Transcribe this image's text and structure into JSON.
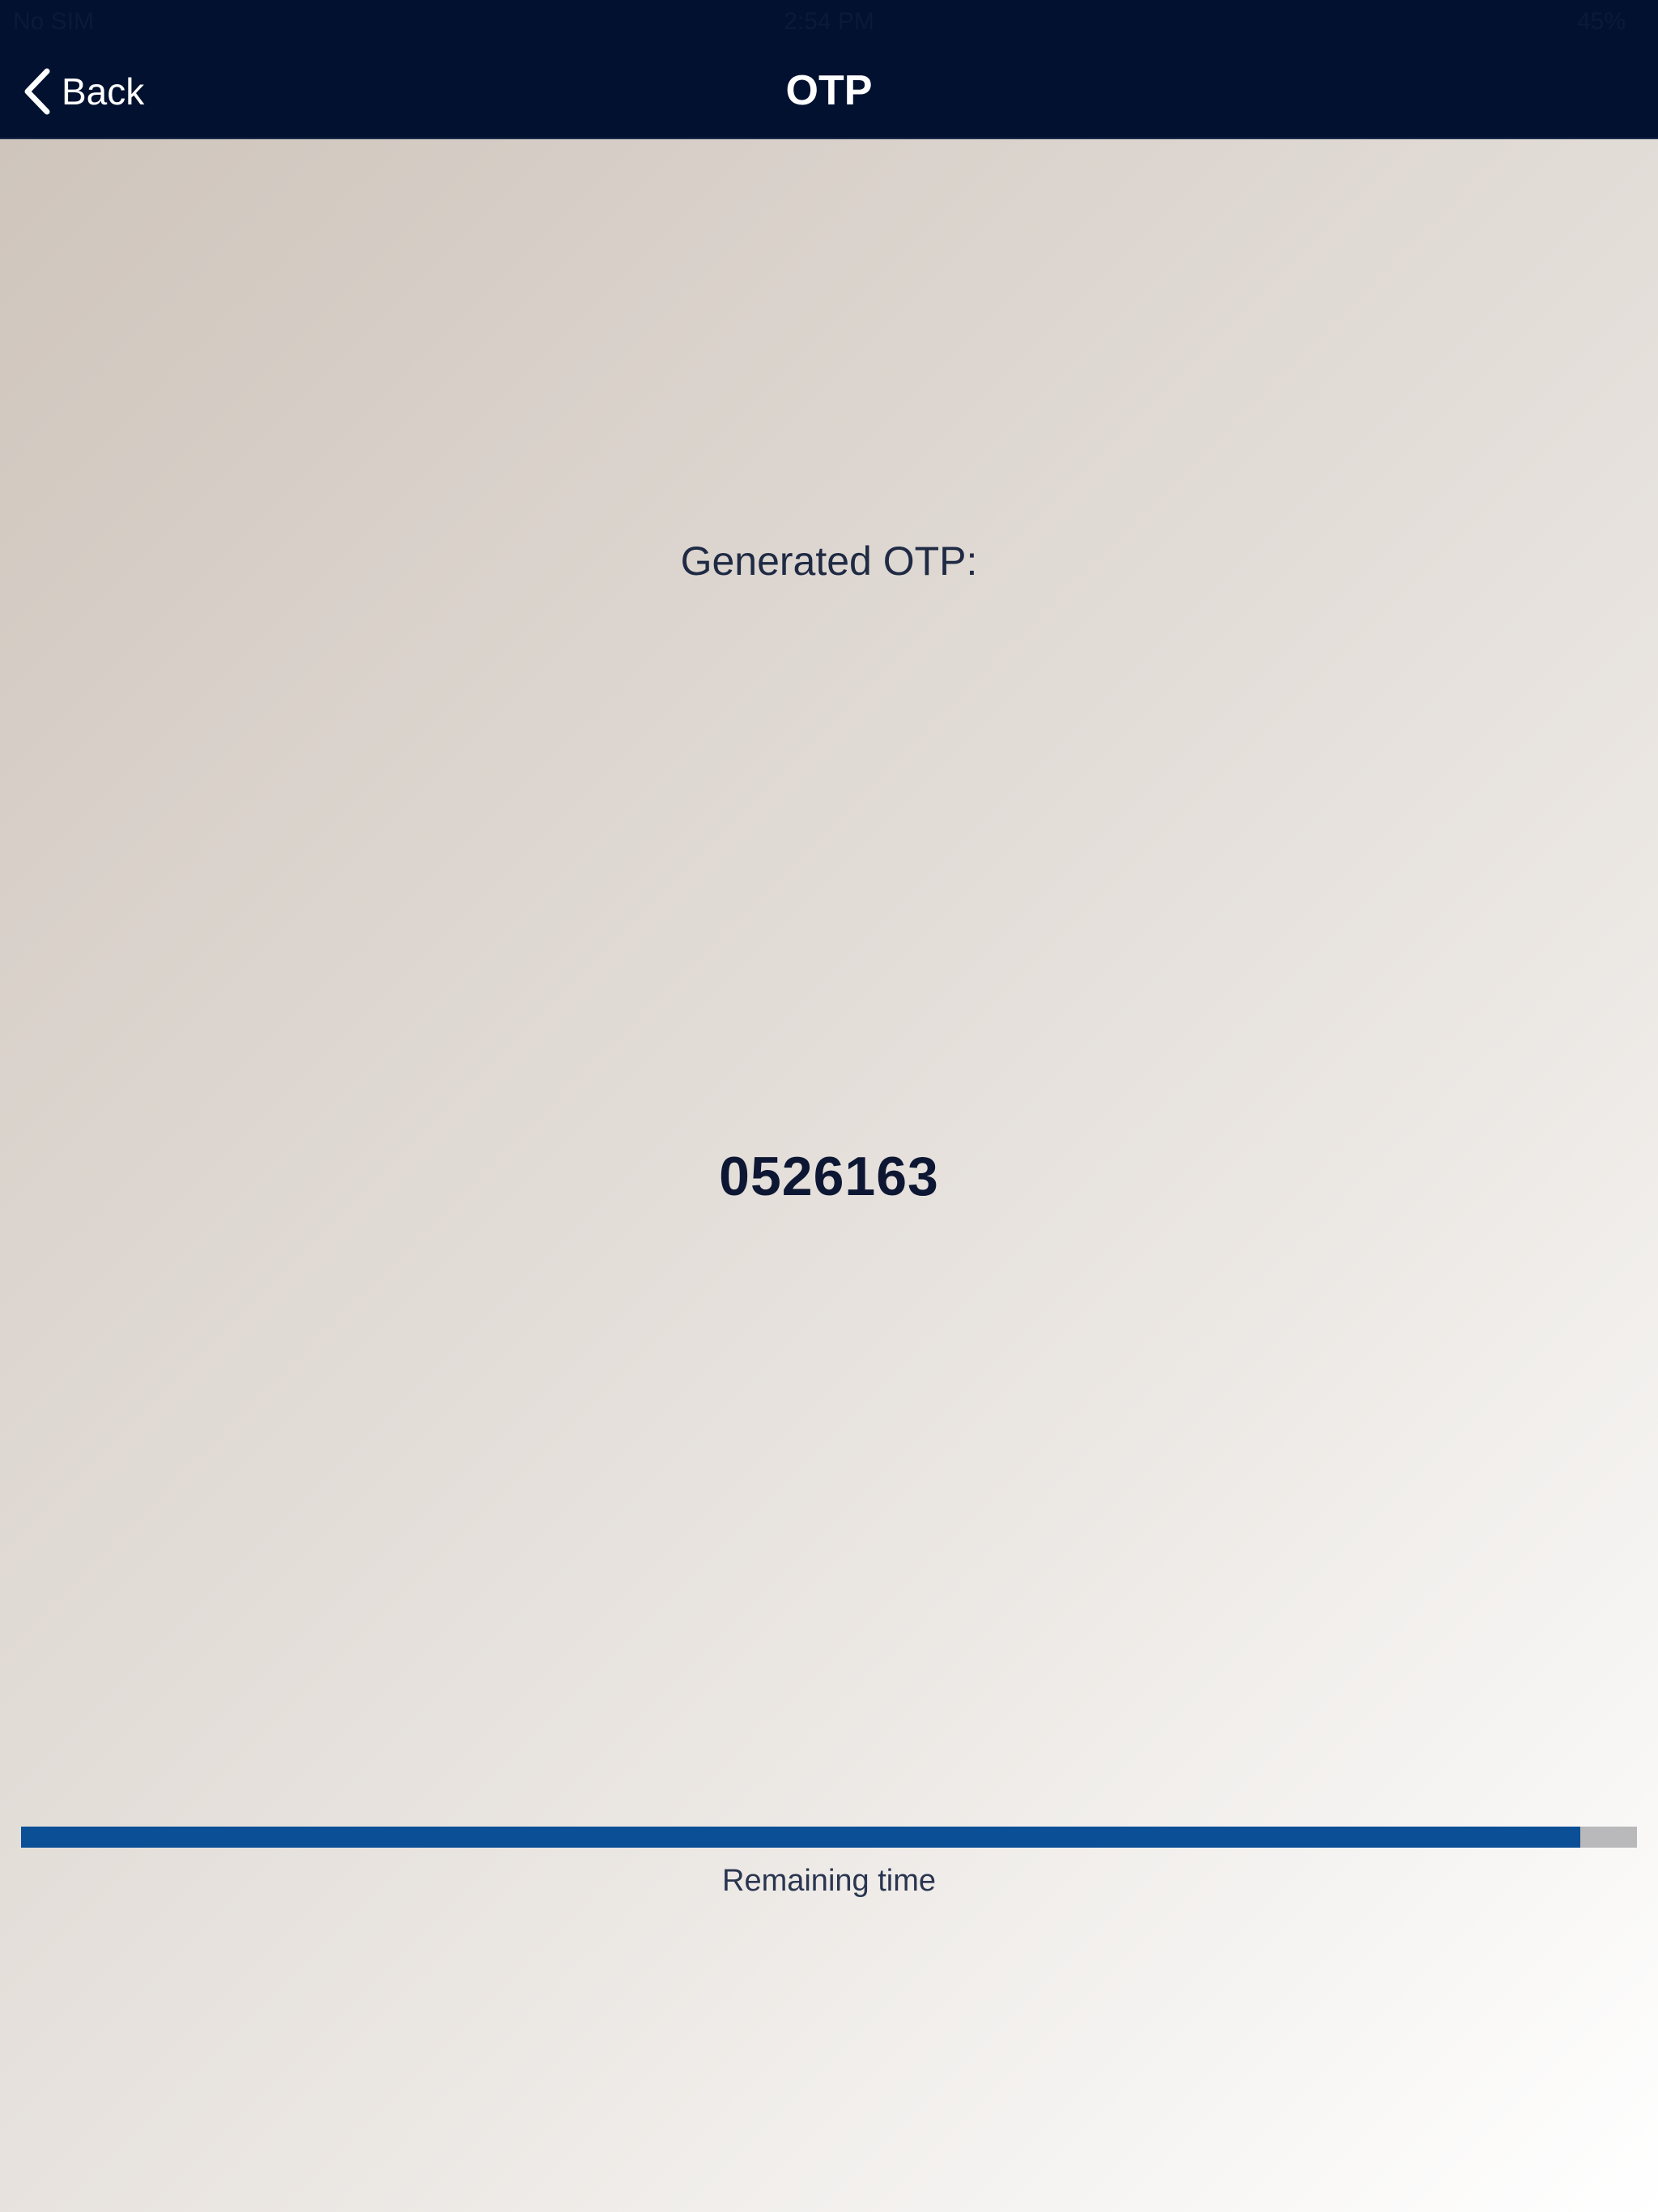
{
  "status_bar": {
    "carrier": "No SIM",
    "time": "2:54 PM",
    "battery": "45%"
  },
  "nav": {
    "back_label": "Back",
    "title": "OTP",
    "back_icon": "chevron-left-icon"
  },
  "otp": {
    "caption": "Generated OTP:",
    "code": "0526163"
  },
  "timer": {
    "remaining_fraction": 0.965,
    "label": "Remaining time",
    "fill_color": "#0b4f96",
    "track_color": "#b9b9bc"
  },
  "colors": {
    "header_bg": "#02112f",
    "text_dark": "#0d1733"
  }
}
